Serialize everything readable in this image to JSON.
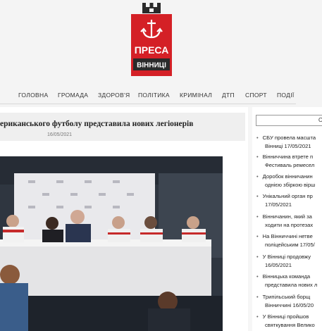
{
  "site": {
    "logo_line1": "ПРЕСА",
    "logo_line2": "ВІННИЦІ",
    "brand_red": "#d42026",
    "brand_dark": "#2a2a2a"
  },
  "nav": {
    "items": [
      {
        "label": "ГОЛОВНА"
      },
      {
        "label": "ГРОМАДА"
      },
      {
        "label": "ЗДОРОВ'Я"
      },
      {
        "label": "ПОЛІТИКА"
      },
      {
        "label": "КРИМІНАЛ"
      },
      {
        "label": "ДТП"
      },
      {
        "label": "СПОРТ"
      },
      {
        "label": "ПОДІЇ"
      }
    ]
  },
  "article": {
    "title": "ериканського футболу представила нових легіонерів",
    "date": "16/05/2021",
    "image_icon": "press-conference-photo"
  },
  "sidebar": {
    "box_label": "О",
    "news": [
      "СБУ провела масшта",
      "Вінниці 17/05/2021",
      "Вінниччина втрете п",
      "Фестиваль ремесел",
      "Доробок вінничанин",
      "однією збіркою вірш",
      "Унікальний орган пр",
      "17/05/2021",
      "Вінничанин, який за",
      "ходити на протезах",
      "На Вінниччині нетве",
      "поліцейським 17/05/",
      "У Вінниці продовжу",
      "16/05/2021",
      "Вінницька команда",
      "представила нових л",
      "Трипільський борщ",
      "Вінниччині 16/05/20",
      "У Вінниці пройшов",
      "святкування Велико"
    ]
  }
}
